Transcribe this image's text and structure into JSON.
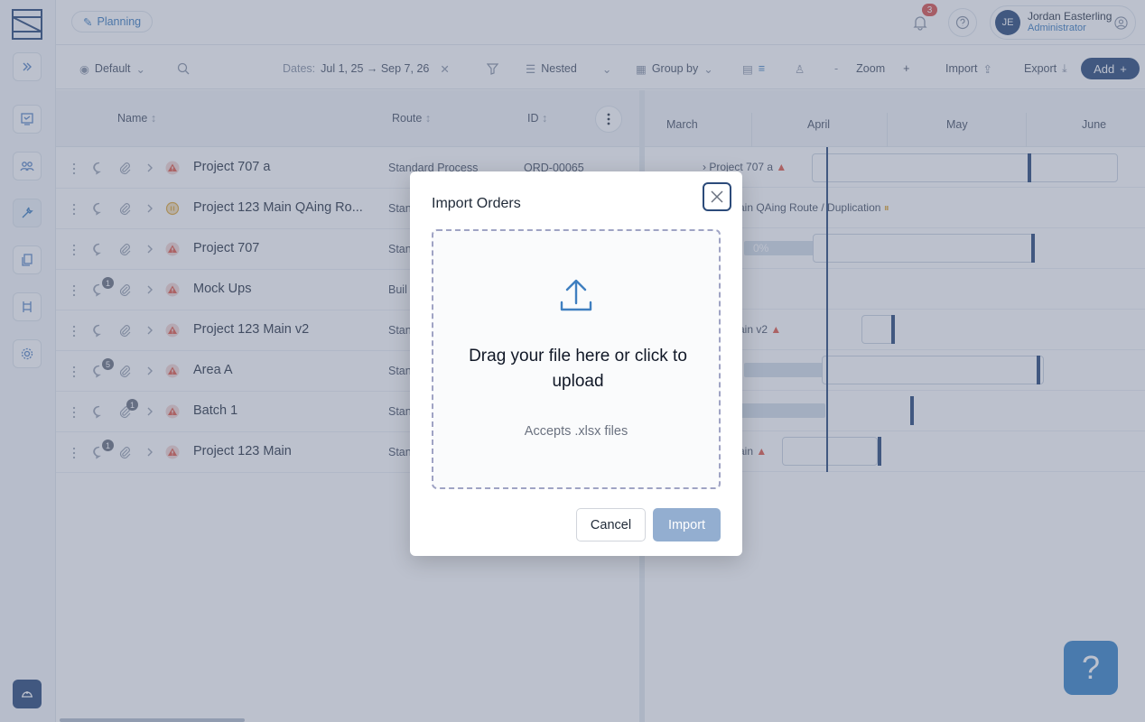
{
  "app": {
    "breadcrumb_label": "Planning"
  },
  "header": {
    "notification_count": "3",
    "user": {
      "initials": "JE",
      "name": "Jordan Easterling",
      "role": "Administrator"
    }
  },
  "toolbar": {
    "view_label": "Default",
    "dates_label": "Dates:",
    "dates_value": "Jul 1, 25 → Sep 7, 26",
    "nested_label": "Nested",
    "groupby_label": "Group by",
    "zoom_label": "Zoom",
    "zoom_minus": "-",
    "zoom_plus": "+",
    "import_label": "Import",
    "export_label": "Export",
    "add_label": "Add"
  },
  "grid": {
    "columns": {
      "name": "Name",
      "route": "Route",
      "id": "ID"
    },
    "rows": [
      {
        "name": "Project 707 a",
        "route": "Standard Process",
        "id": "ORD-00065",
        "status": "warning",
        "chat_count": "",
        "clip_count": ""
      },
      {
        "name": "Project 123 Main QAing Ro...",
        "route": "Stan",
        "id": "",
        "status": "paused",
        "chat_count": "",
        "clip_count": ""
      },
      {
        "name": "Project 707",
        "route": "Stan",
        "id": "",
        "status": "warning",
        "chat_count": "",
        "clip_count": ""
      },
      {
        "name": "Mock Ups",
        "route": "Buil",
        "id": "",
        "status": "warning",
        "chat_count": "1",
        "clip_count": ""
      },
      {
        "name": "Project 123 Main v2",
        "route": "Stan",
        "id": "",
        "status": "warning",
        "chat_count": "",
        "clip_count": ""
      },
      {
        "name": "Area A",
        "route": "Stan",
        "id": "",
        "status": "warning",
        "chat_count": "5",
        "clip_count": ""
      },
      {
        "name": "Batch 1",
        "route": "Stan",
        "id": "",
        "status": "warning",
        "chat_count": "",
        "clip_count": "1"
      },
      {
        "name": "Project 123 Main",
        "route": "Stan",
        "id": "",
        "status": "warning",
        "chat_count": "1",
        "clip_count": ""
      }
    ]
  },
  "gantt": {
    "months": [
      "March",
      "April",
      "May",
      "June"
    ],
    "labels": [
      "Project 707 a",
      "ain QAing Route / Duplication",
      "0%",
      "ain v2",
      "ain"
    ]
  },
  "help_button": "?",
  "modal": {
    "title": "Import Orders",
    "dropzone_title": "Drag your file here or click to upload",
    "dropzone_subtitle": "Accepts .xlsx files",
    "cancel_label": "Cancel",
    "import_label": "Import"
  },
  "colors": {
    "primary": "#2c4b7a",
    "accent": "#3f7fc0",
    "warning": "#e25c4a",
    "paused": "#e0a93b",
    "import_disabled": "#93aed0"
  }
}
